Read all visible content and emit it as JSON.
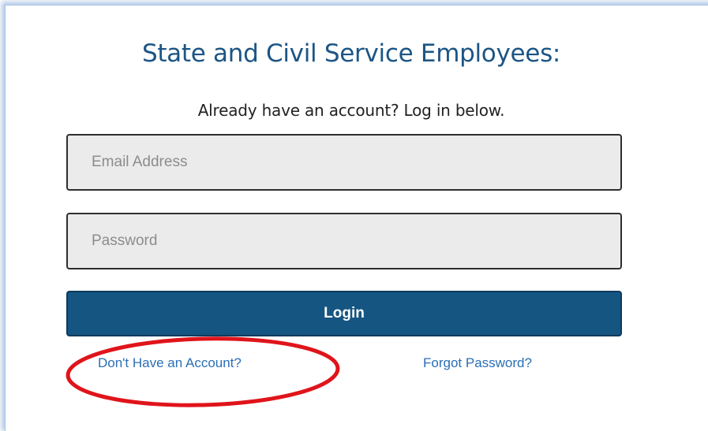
{
  "login": {
    "heading": "State and Civil Service Employees:",
    "subheading": "Already have an account? Log in below.",
    "email_placeholder": "Email Address",
    "password_placeholder": "Password",
    "login_label": "Login",
    "signup_link": "Don't Have an Account?",
    "forgot_link": "Forgot Password?"
  },
  "colors": {
    "heading": "#1c5585",
    "button_bg": "#155582",
    "link": "#2a6fb5",
    "annotation_circle": "#e0141b"
  },
  "annotation": {
    "shape": "ellipse",
    "highlights": "signup_link"
  }
}
